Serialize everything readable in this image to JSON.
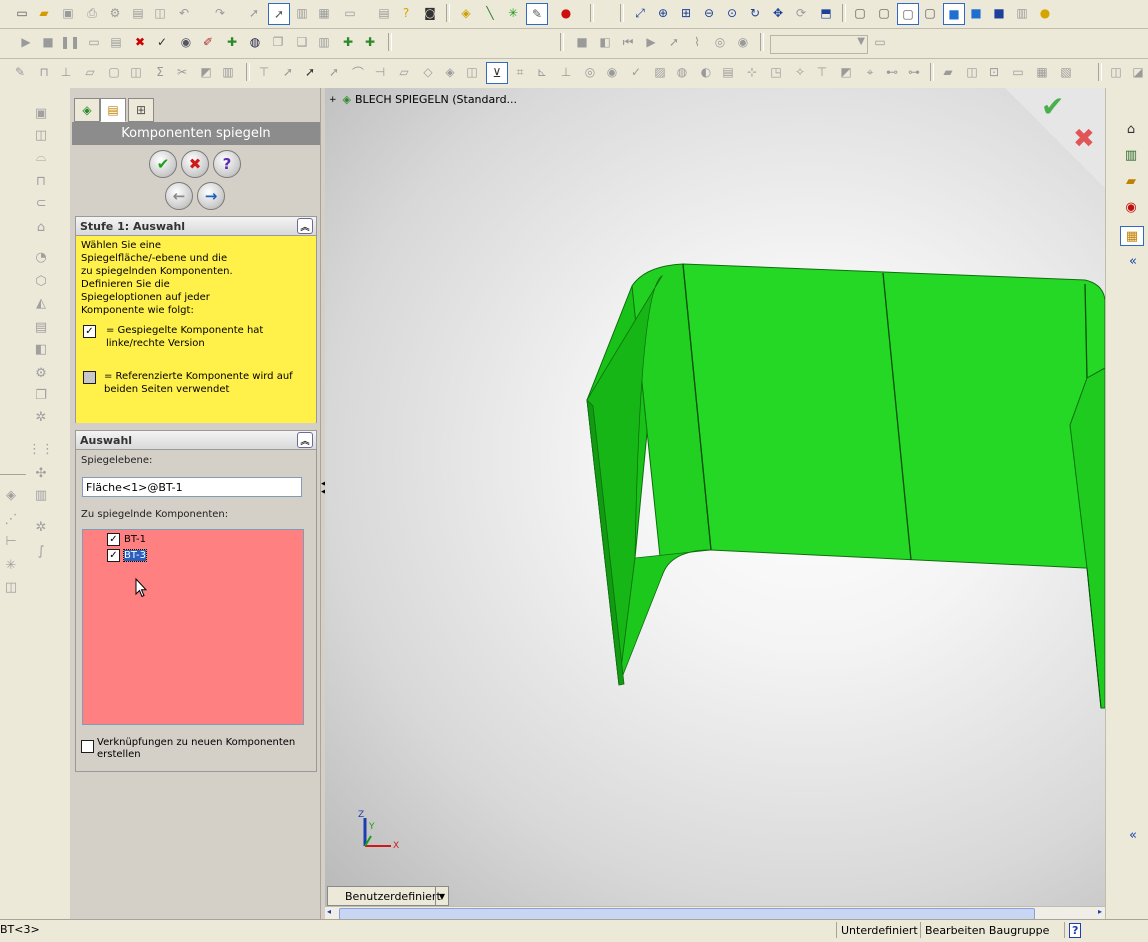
{
  "toolbars": {
    "row1": [
      "new",
      "open",
      "save",
      "print",
      "rebuild",
      "options",
      "undo",
      "redo",
      "select",
      "smart-select",
      "grid",
      "sketch",
      "help",
      "photo",
      "measure",
      "line",
      "point",
      "sketch-edit",
      "record",
      "zoom-fit",
      "zoom-area",
      "zoom-in",
      "zoom-out",
      "zoom-prev",
      "rotate",
      "pan",
      "view",
      "display-style",
      "hidden-lines",
      "wireframe",
      "shaded",
      "material",
      "appearance"
    ],
    "row2": [
      "play",
      "stop",
      "pause",
      "macro1",
      "macro2",
      "macro3",
      "macro4",
      "macro5",
      "macro6",
      "macro7",
      "macro8",
      "macro9"
    ],
    "row3": [
      "sketch-tools",
      "features",
      "surfaces",
      "sheetmetal",
      "mold",
      "weldments",
      "reference",
      "curves",
      "dimensions"
    ],
    "row3_more": "»"
  },
  "property_manager": {
    "title": "Komponenten spiegeln",
    "buttons": {
      "ok": "✔",
      "cancel": "✖",
      "help": "?",
      "back": "←",
      "next": "→"
    },
    "step1": {
      "header": "Stufe 1: Auswahl",
      "instructions": [
        "Wählen Sie eine",
        "Spiegelfläche/-ebene und die",
        "zu spiegelnden Komponenten.",
        "Definieren Sie die",
        "Spiegeloptionen auf jeder",
        "Komponente wie folgt:"
      ],
      "legend_checked_line1": "= Gespiegelte Komponente hat",
      "legend_checked_line2": "linke/rechte Version",
      "legend_unchecked_line1": "= Referenzierte Komponente wird auf",
      "legend_unchecked_line2": "beiden Seiten verwendet"
    },
    "selection": {
      "header": "Auswahl",
      "plane_label": "Spiegelebene:",
      "plane_value": "Fläche<1>@BT-1",
      "components_label": "Zu spiegelnde Komponenten:",
      "components": [
        {
          "name": "BT-1",
          "checked": true,
          "selected": false
        },
        {
          "name": "BT-3",
          "checked": true,
          "selected": true
        }
      ],
      "link_option_line1": "Verknüpfungen zu neuen Komponenten",
      "link_option_line2": "erstellen"
    }
  },
  "viewport": {
    "tree_label": "BLECH SPIEGELN  (Standard...",
    "view_dropdown": "Benutzerdefiniert",
    "axis": {
      "x": "X",
      "y": "Y",
      "z": "Z"
    },
    "part_color": "#1fd21f"
  },
  "status_bar": {
    "left": "BT<3>",
    "state": "Unterdefiniert",
    "mode": "Bearbeiten Baugruppe",
    "help": "?"
  }
}
